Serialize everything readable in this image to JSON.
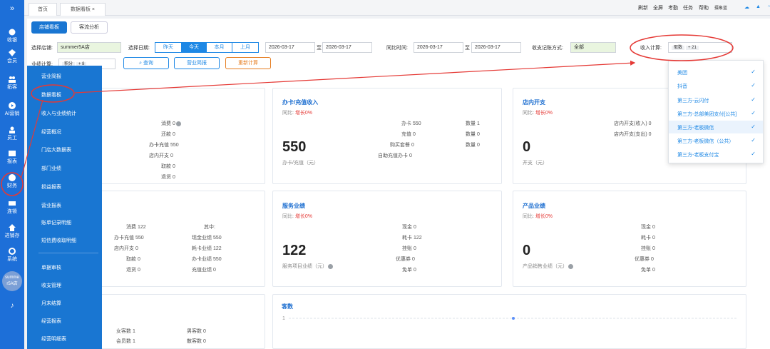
{
  "sidebar": {
    "items": [
      {
        "label": "收银",
        "icon": "money-icon"
      },
      {
        "label": "会员",
        "icon": "diamond-icon"
      },
      {
        "label": "拓客",
        "icon": "users-icon"
      },
      {
        "label": "AI营销",
        "icon": "play-icon"
      },
      {
        "label": "员工",
        "icon": "person-icon"
      },
      {
        "label": "报表",
        "icon": "report-icon"
      },
      {
        "label": "财务",
        "icon": "finance-icon"
      },
      {
        "label": "连锁",
        "icon": "chain-icon"
      },
      {
        "label": "进销存",
        "icon": "home-icon"
      },
      {
        "label": "系统",
        "icon": "gear-icon"
      }
    ],
    "store_badge": "summe r5A店"
  },
  "tabs": [
    {
      "label": "首页"
    },
    {
      "label": "数据看板"
    }
  ],
  "toolbar_links": [
    "刷新",
    "全屏",
    "考勤",
    "任务",
    "帮助",
    "摄象蓝"
  ],
  "subtabs": [
    "店铺看板",
    "客流分析"
  ],
  "filters": {
    "store_label": "选择店铺:",
    "store_value": "summer5A店",
    "date_label": "选择日期:",
    "date_segments": [
      "昨天",
      "今天",
      "本月",
      "上月"
    ],
    "date_from": "2026-03-17",
    "date_sep": "至",
    "date_to": "2026-03-17",
    "compare_label": "同比时间:",
    "compare_from": "2026-03-17",
    "compare_to": "2026-03-17",
    "record_label": "收支记账方式:",
    "record_value": "全部",
    "income_label": "收入计算:",
    "income_tag": "取数",
    "income_more": "+ 21",
    "perf_label": "业绩计算:",
    "perf_tag": "积分",
    "perf_more": "+ 8"
  },
  "buttons": {
    "query": "查询",
    "brief": "营业简报",
    "recalc": "重新计算"
  },
  "cards": {
    "total": {
      "lines": [
        "消费 0",
        "还款 0",
        "办卡充值 550",
        "店内开支 0",
        "取款 0",
        "退货 0"
      ]
    },
    "card_income": {
      "title": "办卡/充值收入",
      "compare": "同比:",
      "compare_val": "增长0%",
      "big": "550",
      "sub": "办卡/充值（元）",
      "col1": [
        "办卡 550",
        "充值 0",
        "购买套餐 0",
        "自助充值办卡 0"
      ],
      "col2": [
        "数量 1",
        "数量 0",
        "数量 0"
      ]
    },
    "expense": {
      "title": "店内开支",
      "compare": "同比:",
      "compare_val": "增长0%",
      "big": "0",
      "sub": "开支（元）",
      "lines": [
        "店内开支(收入) 0",
        "店内开支(支出) 0"
      ]
    },
    "perf": {
      "col1": [
        "消费 122",
        "办卡充值 550",
        "店内开支 0",
        "取款 0",
        "退货 0"
      ],
      "col2": [
        "其中:",
        "现金业绩 550",
        "耗卡业绩 122",
        "办卡业绩 550",
        "充值业绩 0"
      ]
    },
    "service": {
      "title": "服务业绩",
      "compare": "同比:",
      "compare_val": "增长0%",
      "big": "122",
      "sub": "服务项目业绩（元）",
      "lines": [
        "现金 0",
        "耗卡 122",
        "挂账 0",
        "优惠券 0",
        "免单 0"
      ]
    },
    "product": {
      "title": "产品业绩",
      "compare": "同比:",
      "compare_val": "增长0%",
      "big": "0",
      "sub": "产品销售业绩（元）",
      "lines": [
        "现金 0",
        "耗卡 0",
        "挂账 0",
        "优惠券 0",
        "免单 0"
      ]
    },
    "guests": {
      "col1": [
        "女客数 1",
        "会员数 1"
      ],
      "col2": [
        "男客数 0",
        "散客数 0"
      ]
    },
    "traffic": {
      "title": "客数",
      "axis_value": "1"
    }
  },
  "menu": {
    "items": [
      "营业简报",
      "数据看板",
      "收入与业绩统计",
      "经营概况",
      "门店大数据表",
      "部门业绩",
      "损益报表",
      "营业报表",
      "账单记录明细",
      "短信费收取明细",
      "单据审核",
      "收支管理",
      "月末结算",
      "经营报表",
      "经营明细表"
    ]
  },
  "dropdown": {
    "items": [
      "美团",
      "抖音",
      "第三方-云闪付",
      "第三方-总部美团支付[公共]",
      "第三方-老板微信",
      "第三方-老板微信（公共）",
      "第三方-老板支付宝"
    ]
  },
  "colors": {
    "primary": "#1976d2",
    "annotation": "#e53935",
    "accent": "#1e88e5"
  }
}
